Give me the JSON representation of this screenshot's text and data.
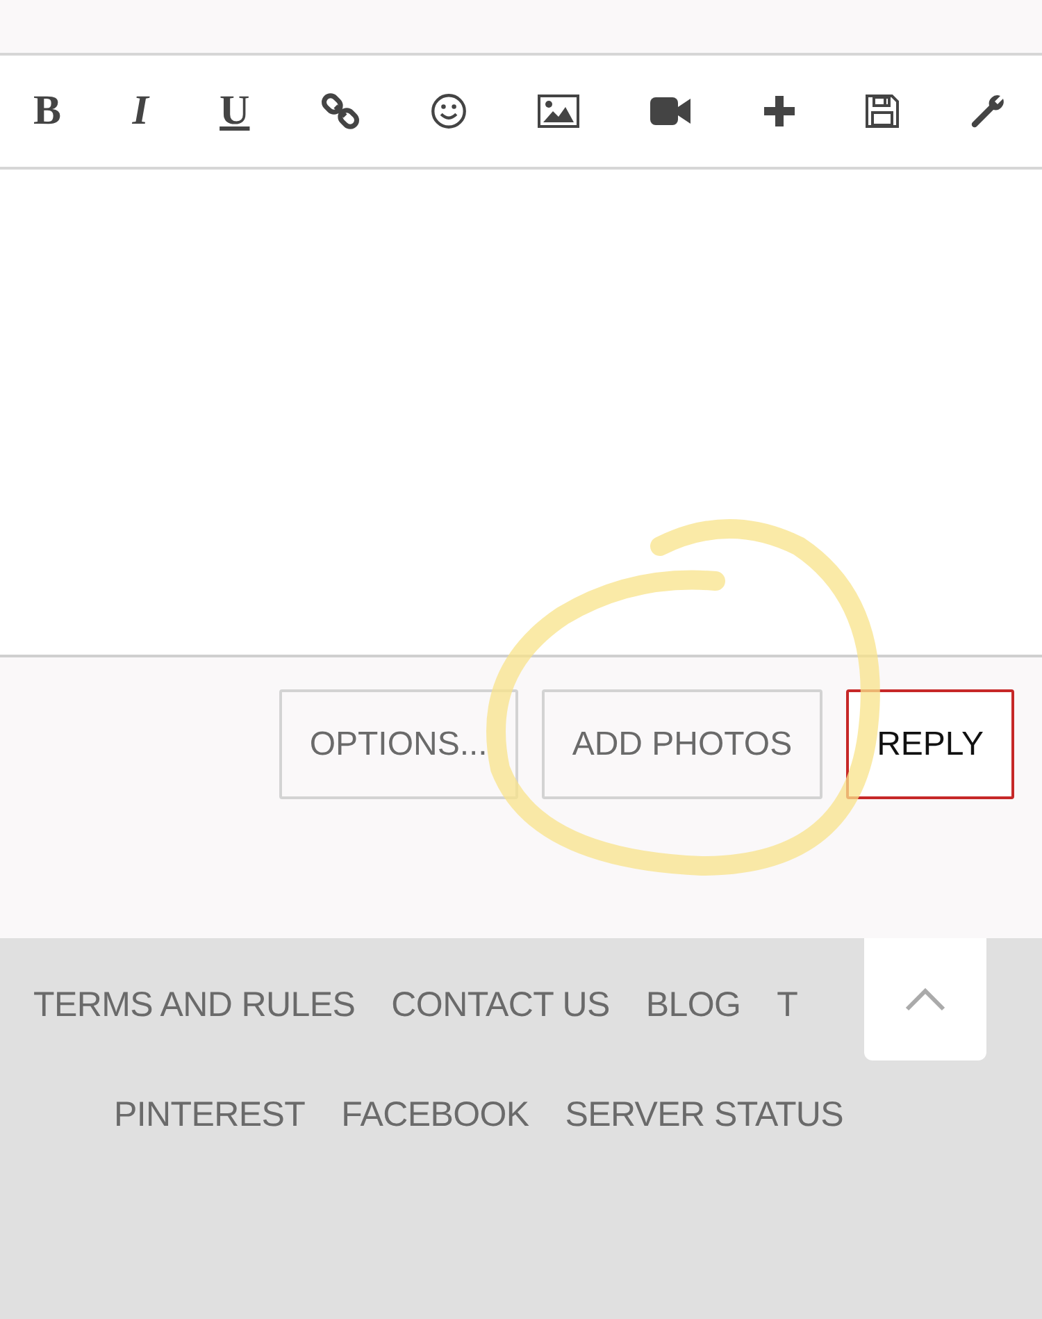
{
  "toolbar": [
    {
      "kind": "bold",
      "label": "B"
    },
    {
      "kind": "italic",
      "label": "I"
    },
    {
      "kind": "underline",
      "label": "U"
    },
    {
      "kind": "link"
    },
    {
      "kind": "smiley"
    },
    {
      "kind": "image"
    },
    {
      "kind": "video"
    },
    {
      "kind": "plus"
    },
    {
      "kind": "save"
    },
    {
      "kind": "wrench"
    }
  ],
  "actions": [
    {
      "label": "OPTIONS...",
      "primary": false
    },
    {
      "label": "ADD PHOTOS",
      "primary": false
    },
    {
      "label": "REPLY",
      "primary": true
    }
  ],
  "footer_rows": [
    [
      "TERMS AND RULES",
      "CONTACT US",
      "BLOG",
      "T"
    ],
    [
      "PINTEREST",
      "FACEBOOK",
      "SERVER STATUS"
    ]
  ]
}
